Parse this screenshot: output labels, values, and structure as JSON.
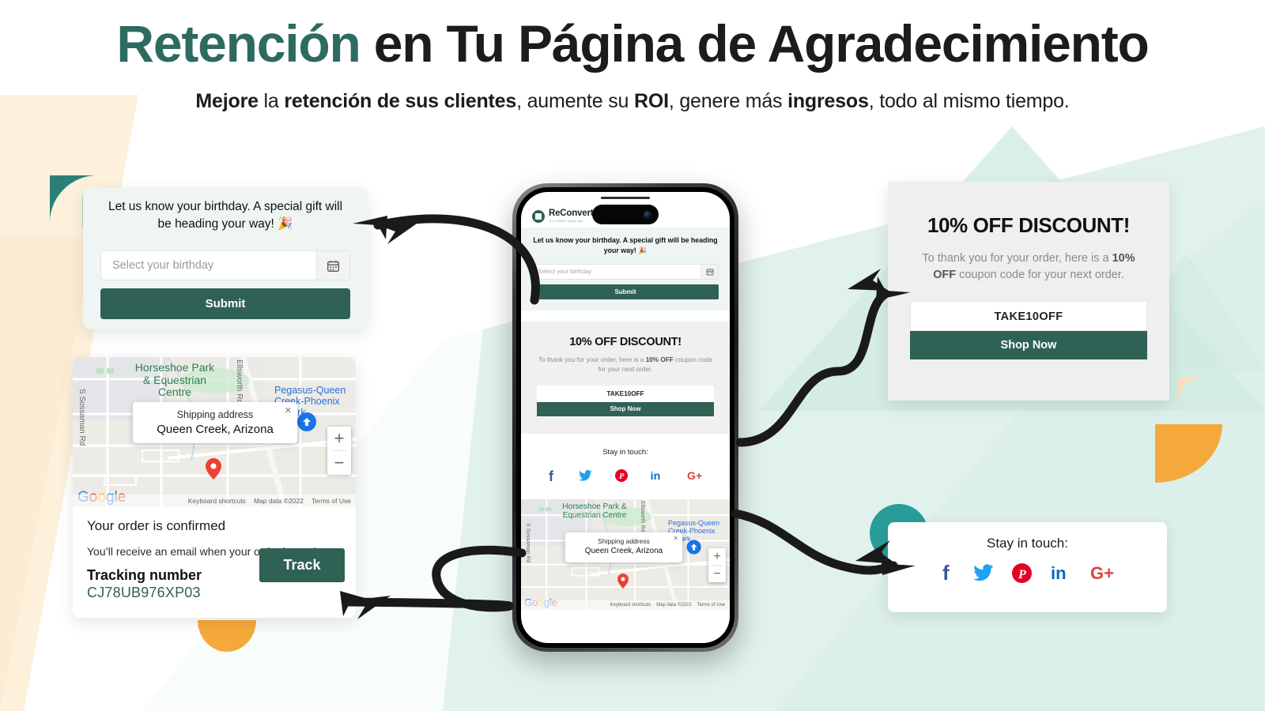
{
  "header": {
    "title_accent": "Retención",
    "title_rest": " en Tu Página de Agradecimiento",
    "subtitle_parts": [
      {
        "t": "Mejore",
        "b": true
      },
      {
        "t": " la ",
        "b": false
      },
      {
        "t": "retención de sus clientes",
        "b": true
      },
      {
        "t": ", aumente su ",
        "b": false
      },
      {
        "t": "ROI",
        "b": true
      },
      {
        "t": ", genere más ",
        "b": false
      },
      {
        "t": "ingresos",
        "b": true
      },
      {
        "t": ", todo al mismo tiempo.",
        "b": false
      }
    ],
    "subtitle_plain": "Mejore la retención de sus clientes, aumente su ROI, genere más ingresos, todo al mismo tiempo."
  },
  "birthday_card": {
    "message": "Let us know your birthday. A special gift will be heading your way! 🎉",
    "input_placeholder": "Select your birthday",
    "calendar_icon": "calendar-icon",
    "submit_label": "Submit"
  },
  "order_card": {
    "title": "Your order is confirmed",
    "subtitle": "You’ll receive an email when your order is ready.",
    "tracking_label": "Tracking number",
    "tracking_number": "CJ78UB976XP03",
    "track_button": "Track"
  },
  "map": {
    "tooltip_title": "Shipping address",
    "tooltip_value": "Queen Creek, Arizona",
    "close_icon": "close-icon",
    "labels": {
      "park": "Horseshoe Park & Equestrian Centre",
      "road_left": "S Sossaman Rd",
      "road_mid": "Ellsworth Rd",
      "airpark": "Pegasus-Queen Creek-Phoenix Airpark"
    },
    "zoom_in": "+",
    "zoom_out": "−",
    "brand": "Google",
    "footer": [
      "Keyboard shortcuts",
      "Map data ©2022",
      "Terms of Use"
    ]
  },
  "discount_card": {
    "title": "10% OFF DISCOUNT!",
    "body_pre": "To thank you for your order, here is a ",
    "body_bold1": "10% OFF",
    "body_post": " coupon code for your next order.",
    "coupon_code": "TAKE10OFF",
    "shop_now": "Shop Now"
  },
  "social_card": {
    "title": "Stay in touch:",
    "icons": [
      {
        "name": "facebook-icon",
        "glyph": "f",
        "color": "#3b5998"
      },
      {
        "name": "twitter-icon",
        "glyph": "t",
        "color": "#1da1f2"
      },
      {
        "name": "pinterest-icon",
        "glyph": "p",
        "color": "#e60023"
      },
      {
        "name": "linkedin-icon",
        "glyph": "in",
        "color": "#0a66c2"
      },
      {
        "name": "googleplus-icon",
        "glyph": "G+",
        "color": "#db4437"
      }
    ]
  },
  "phone": {
    "logo_name": "ReConvert",
    "logo_tagline": "The Ultimate Upsell App"
  },
  "colors": {
    "brand_teal": "#2d6a62",
    "button_green": "#2f6154",
    "accent_orange": "#f5a93c",
    "accent_teal_circle": "#2a9d9b",
    "mint_light": "#c9e8df",
    "bg_mint": "#e4f2ef",
    "bg_cream": "#fdf1dd",
    "heading_dark": "#1c1c1c"
  }
}
